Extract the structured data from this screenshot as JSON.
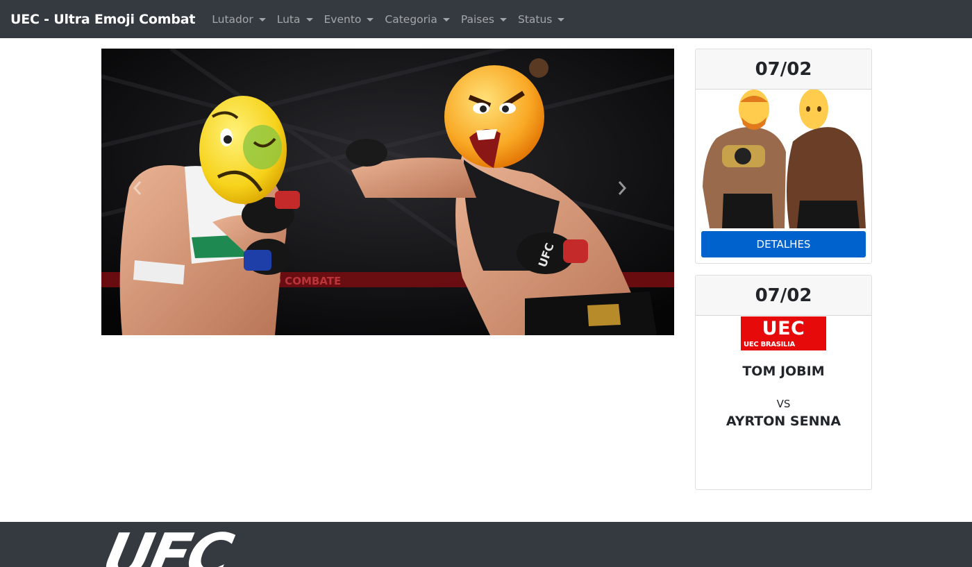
{
  "navbar": {
    "brand": "UEC - Ultra Emoji Combat",
    "items": [
      {
        "label": "Lutador"
      },
      {
        "label": "Luta"
      },
      {
        "label": "Evento"
      },
      {
        "label": "Categoria"
      },
      {
        "label": "Paises"
      },
      {
        "label": "Status"
      }
    ]
  },
  "carousel": {
    "prev_icon": "chevron-left-icon",
    "next_icon": "chevron-right-icon",
    "banner_text": "UFC NO COMBATE",
    "glove_text": "UFC"
  },
  "cards": [
    {
      "date": "07/02",
      "button_label": "DETALHES"
    },
    {
      "date": "07/02",
      "logo_main": "UEC",
      "logo_sub": "UEC BRASILIA",
      "fighter_a": "TOM JOBIM",
      "vs": "VS",
      "fighter_b": "AYRTON SENNA"
    }
  ],
  "footer": {
    "logo": "UEC"
  },
  "colors": {
    "navbar_bg": "#343a40",
    "primary": "#0062cc",
    "uec_red": "#e60a0a"
  }
}
